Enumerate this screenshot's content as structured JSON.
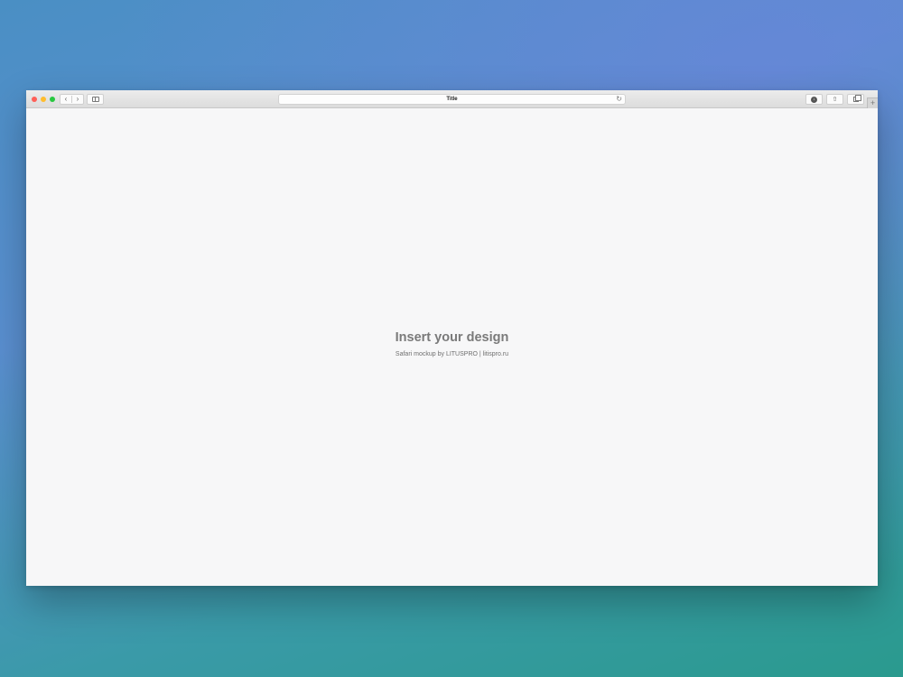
{
  "browser": {
    "address_title": "Title",
    "reload_glyph": "↻",
    "back_glyph": "‹",
    "forward_glyph": "›",
    "download_glyph": "↓",
    "share_glyph": "⇧",
    "new_tab_glyph": "+"
  },
  "content": {
    "headline": "Insert your design",
    "credit": "Safari mockup by LITUSPRO | litispro.ru"
  },
  "colors": {
    "close": "#ff5f57",
    "minimize": "#ffbd2e",
    "maximize": "#28c840"
  }
}
